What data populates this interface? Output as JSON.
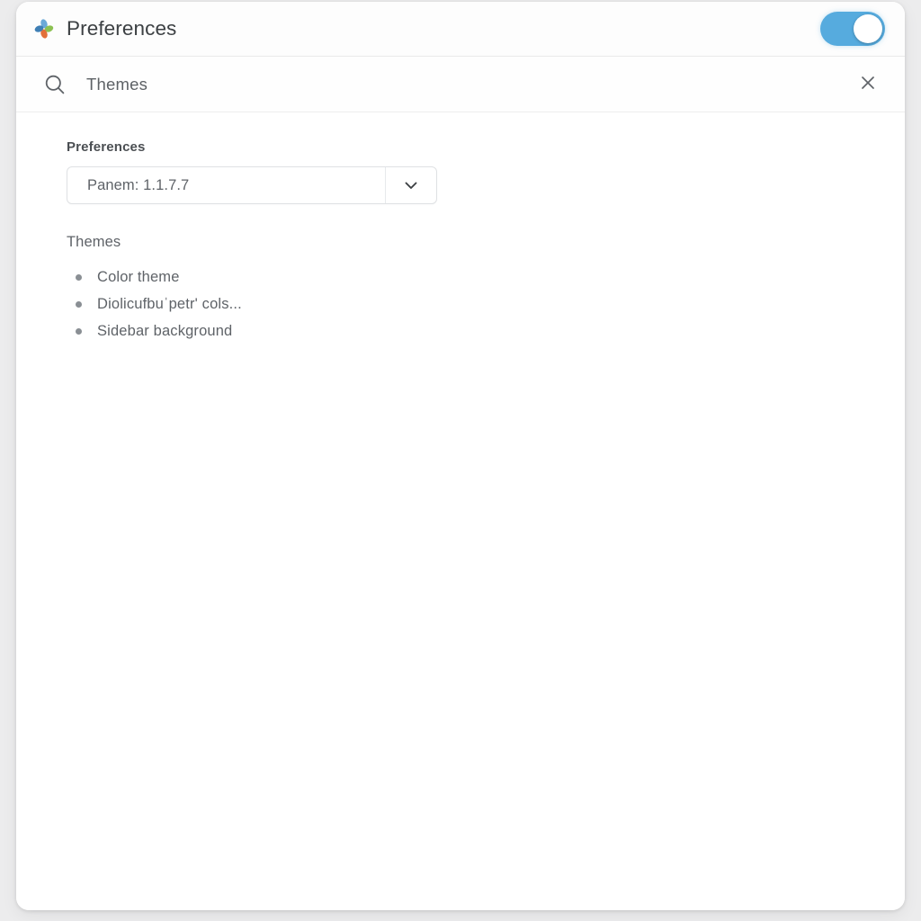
{
  "window": {
    "title": "Preferences",
    "logo_icon": "pinwheel-logo-icon",
    "logo_colors": [
      "#3f7fb5",
      "#8cc152",
      "#e2703a",
      "#6aa9d8"
    ]
  },
  "titlebar": {
    "toggle": {
      "name": "preferences-toggle",
      "state": "on",
      "track_color": "#56abde",
      "knob_color": "#ffffff"
    }
  },
  "search": {
    "icon": "search-icon",
    "value": "Themes",
    "placeholder": "Search",
    "clear_icon": "close-icon"
  },
  "main": {
    "preferences_section": {
      "heading": "Preferences",
      "dropdown": {
        "selected": "Panem: 1.1.7.7",
        "arrow_icon": "chevron-down-icon"
      }
    },
    "themes_section": {
      "heading": "Themes",
      "items": [
        {
          "label": "Color theme"
        },
        {
          "label": "Diolicufbuˈpetr' cols..."
        },
        {
          "label": "Sidebar background"
        }
      ]
    }
  },
  "colors": {
    "page_background": "#ececed",
    "card_background": "#ffffff",
    "accent": "#56abde",
    "text_primary": "#3c4043",
    "text_secondary": "#5f6368"
  }
}
